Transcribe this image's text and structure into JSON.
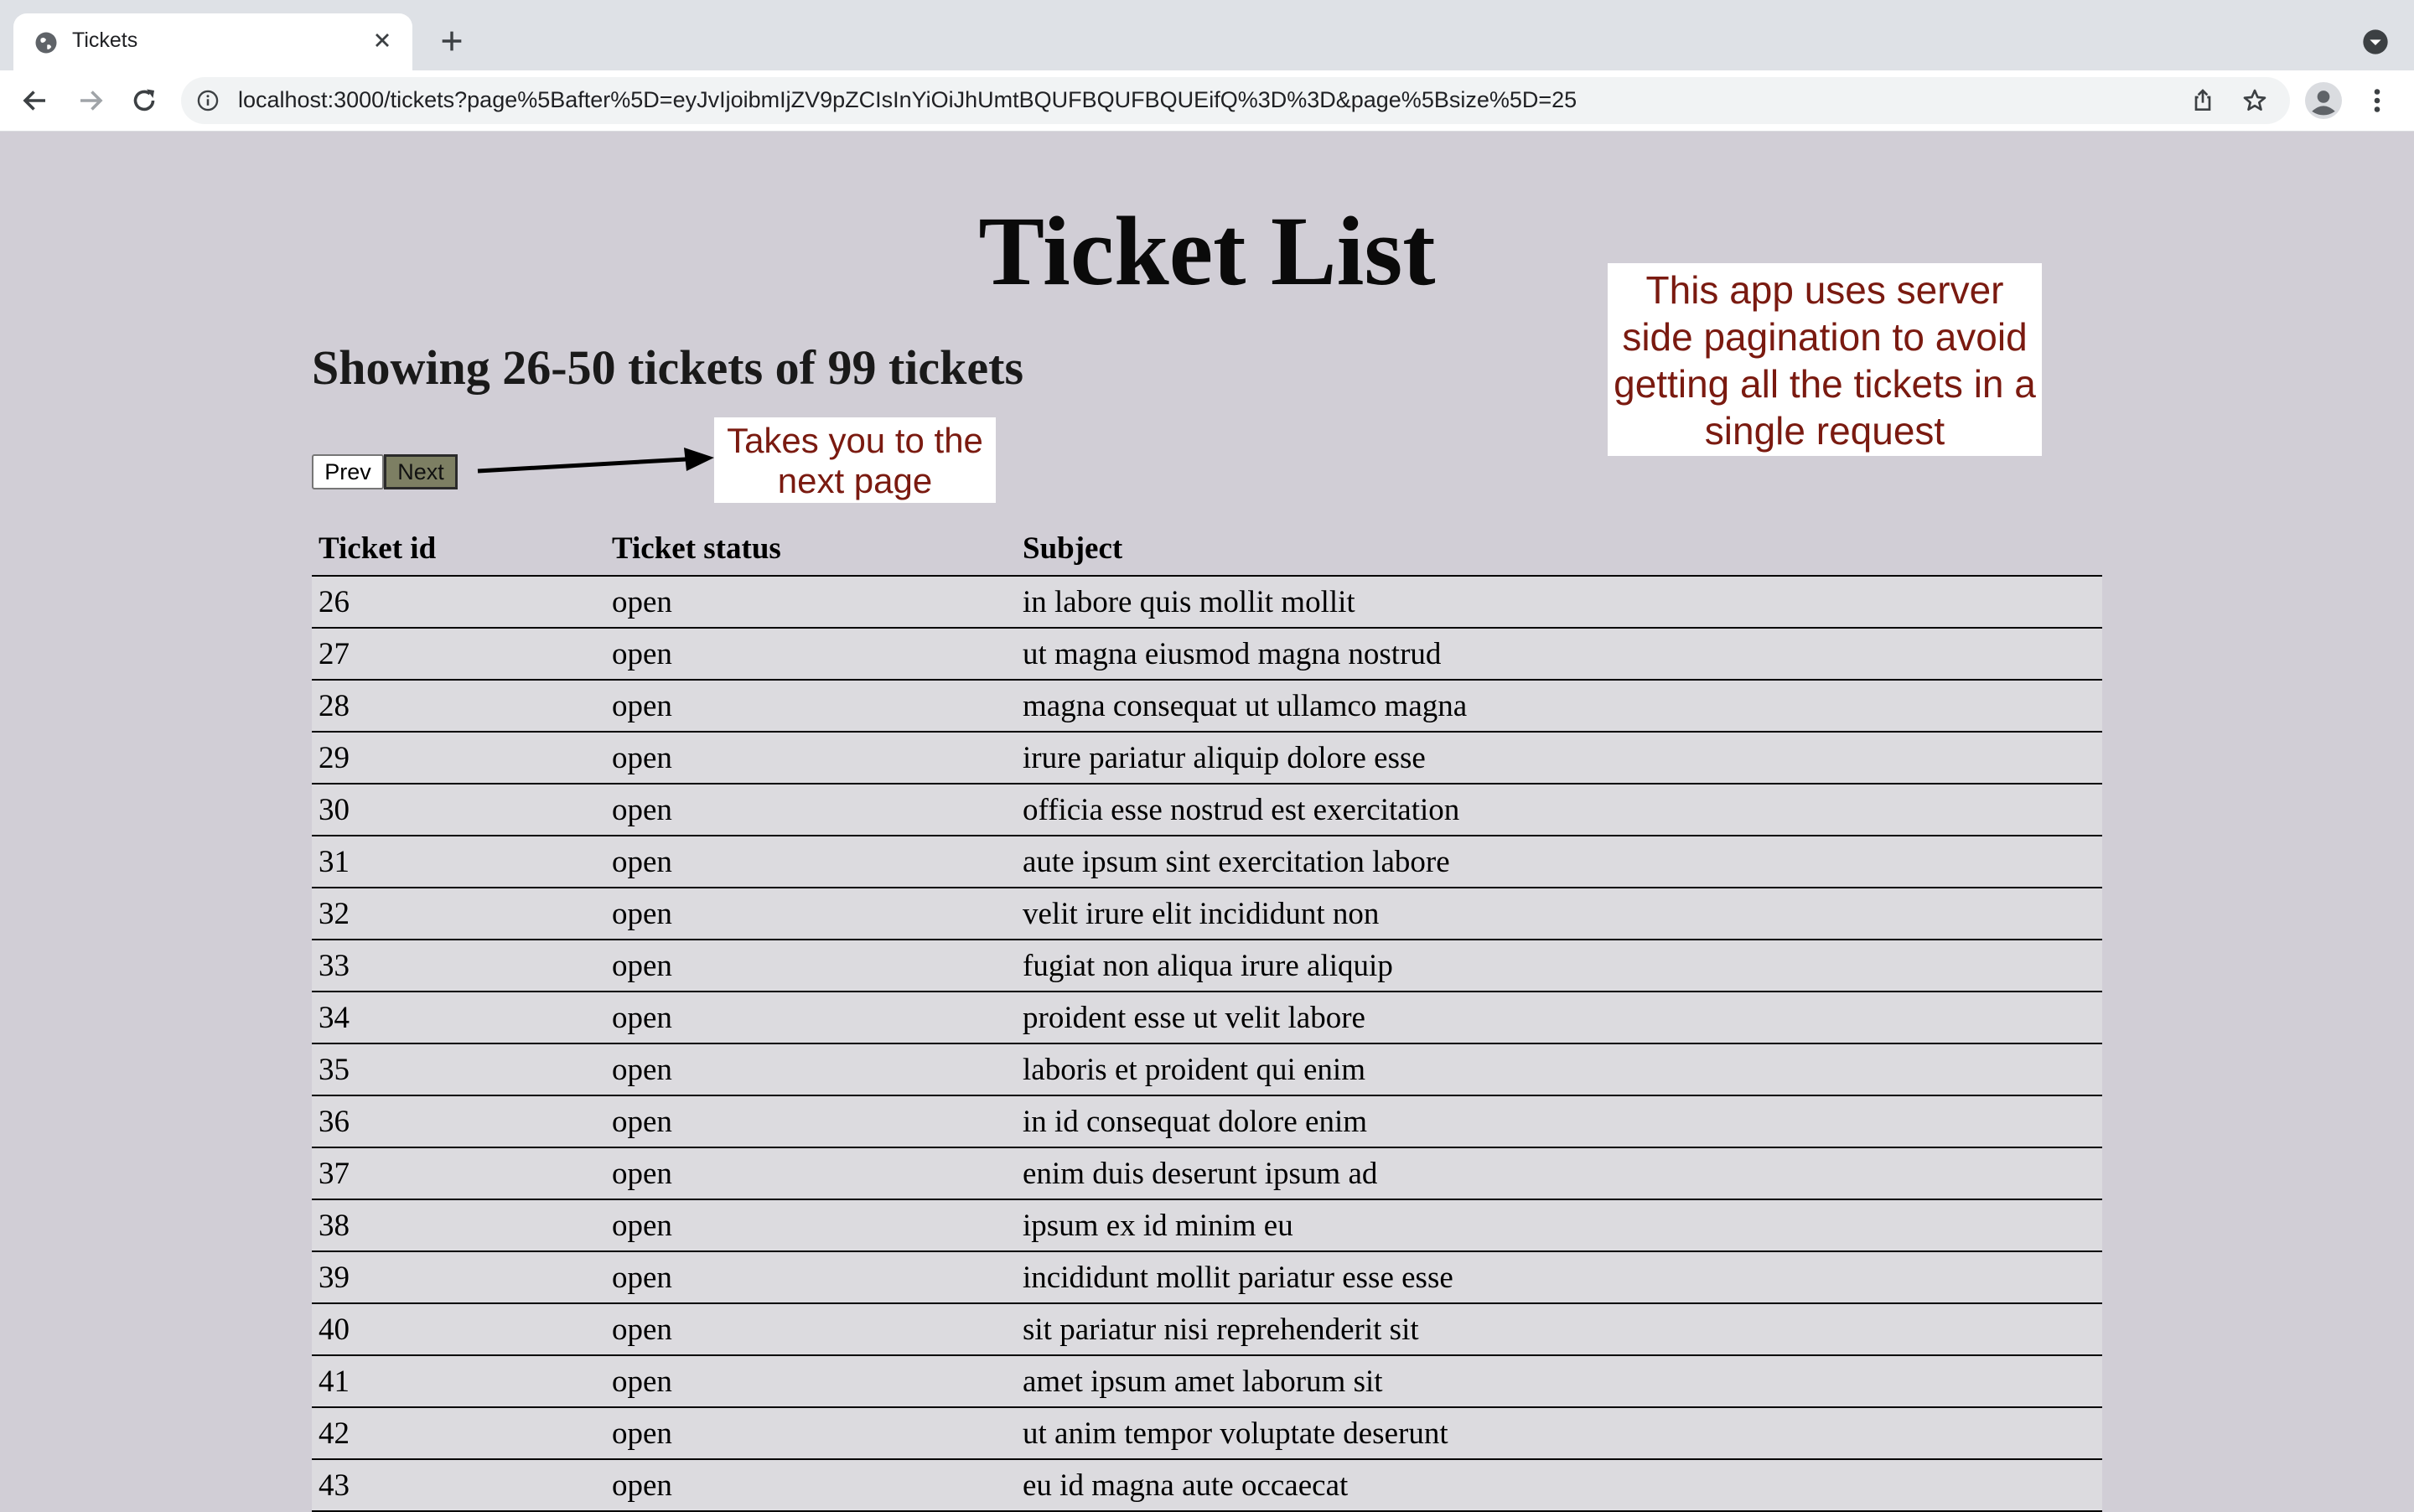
{
  "browser": {
    "tab_title": "Tickets",
    "url": "localhost:3000/tickets?page%5Bafter%5D=eyJvIjoibmIjZV9pZCIsInYiOiJhUmtBQUFBQUFBQUEifQ%3D%3D&page%5Bsize%5D=25",
    "icons": [
      "globe-icon",
      "close-icon",
      "plus-icon",
      "back-icon",
      "forward-icon",
      "reload-icon",
      "info-icon",
      "share-icon",
      "star-icon",
      "profile-icon",
      "more-icon",
      "tab-search-icon"
    ]
  },
  "page": {
    "title": "Ticket List",
    "showing": "Showing 26-50 tickets of 99 tickets",
    "pagination": {
      "prev_label": "Prev",
      "next_label": "Next"
    },
    "annotations": {
      "next_callout": "Takes you to the next page",
      "server_callout": "This app uses server side pagination to avoid getting all the tickets in a single request",
      "color": "#7a1a10"
    },
    "table": {
      "headers": [
        "Ticket id",
        "Ticket status",
        "Subject"
      ],
      "rows": [
        [
          "26",
          "open",
          "in labore quis mollit mollit"
        ],
        [
          "27",
          "open",
          "ut magna eiusmod magna nostrud"
        ],
        [
          "28",
          "open",
          "magna consequat ut ullamco magna"
        ],
        [
          "29",
          "open",
          "irure pariatur aliquip dolore esse"
        ],
        [
          "30",
          "open",
          "officia esse nostrud est exercitation"
        ],
        [
          "31",
          "open",
          "aute ipsum sint exercitation labore"
        ],
        [
          "32",
          "open",
          "velit irure elit incididunt non"
        ],
        [
          "33",
          "open",
          "fugiat non aliqua irure aliquip"
        ],
        [
          "34",
          "open",
          "proident esse ut velit labore"
        ],
        [
          "35",
          "open",
          "laboris et proident qui enim"
        ],
        [
          "36",
          "open",
          "in id consequat dolore enim"
        ],
        [
          "37",
          "open",
          "enim duis deserunt ipsum ad"
        ],
        [
          "38",
          "open",
          "ipsum ex id minim eu"
        ],
        [
          "39",
          "open",
          "incididunt mollit pariatur esse esse"
        ],
        [
          "40",
          "open",
          "sit pariatur nisi reprehenderit sit"
        ],
        [
          "41",
          "open",
          "amet ipsum amet laborum sit"
        ],
        [
          "42",
          "open",
          "ut anim tempor voluptate deserunt"
        ],
        [
          "43",
          "open",
          "eu id magna aute occaecat"
        ]
      ]
    }
  }
}
